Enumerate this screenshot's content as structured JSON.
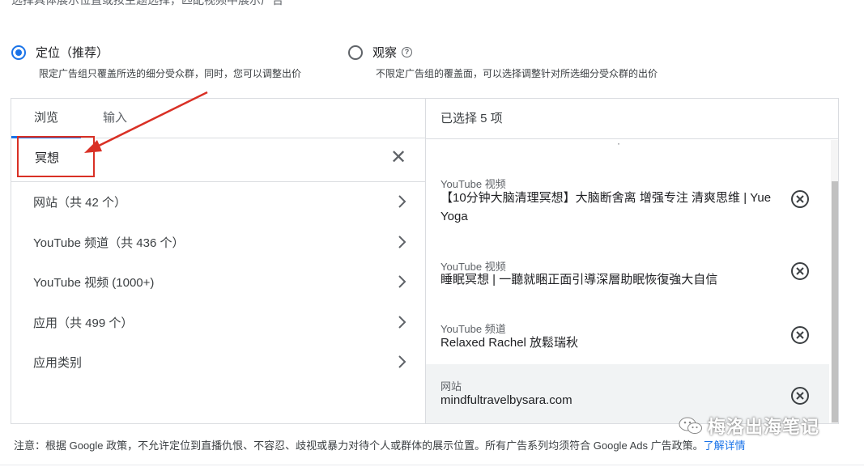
{
  "top_cut_text": "选择具体展示位置或按主题选择，匹配视频中展示广告",
  "targeting_options": [
    {
      "label": "定位（推荐）",
      "desc": "限定广告组只覆盖所选的细分受众群，同时，您可以调整出价",
      "selected": true
    },
    {
      "label": "观察",
      "desc": "不限定广告组的覆盖面，可以选择调整针对所选细分受众群的出价",
      "selected": false
    }
  ],
  "tabs": [
    {
      "label": "浏览",
      "active": true
    },
    {
      "label": "输入",
      "active": false
    }
  ],
  "search": {
    "value": "冥想"
  },
  "categories": [
    {
      "label": "网站（共 42 个）"
    },
    {
      "label": "YouTube 频道（共 436 个）"
    },
    {
      "label": "YouTube 视频 (1000+)"
    },
    {
      "label": "应用（共 499 个）"
    },
    {
      "label": "应用类别"
    }
  ],
  "selected": {
    "header": "已选择 5 项",
    "items": [
      {
        "type": "YouTube 视频",
        "name": "【10分钟大脑清理冥想】大脑断舍离 增强专注 清爽思维 | Yue Yoga"
      },
      {
        "type": "YouTube 视频",
        "name": "睡眠冥想 | 一聽就睏正面引導深層助眠恢復強大自信"
      },
      {
        "type": "YouTube 频道",
        "name": "Relaxed Rachel 放鬆瑞秋"
      },
      {
        "type": "网站",
        "name": "mindfultravelbysara.com"
      }
    ]
  },
  "policy": {
    "text": "注意：根据 Google 政策，不允许定位到直播仇恨、不容忍、歧视或暴力对待个人或群体的展示位置。所有广告系列均须符合 Google Ads 广告政策。",
    "link": "了解详情"
  },
  "watermark": "梅洛出海笔记",
  "colors": {
    "accent": "#1a73e8",
    "annotation": "#d93025"
  }
}
